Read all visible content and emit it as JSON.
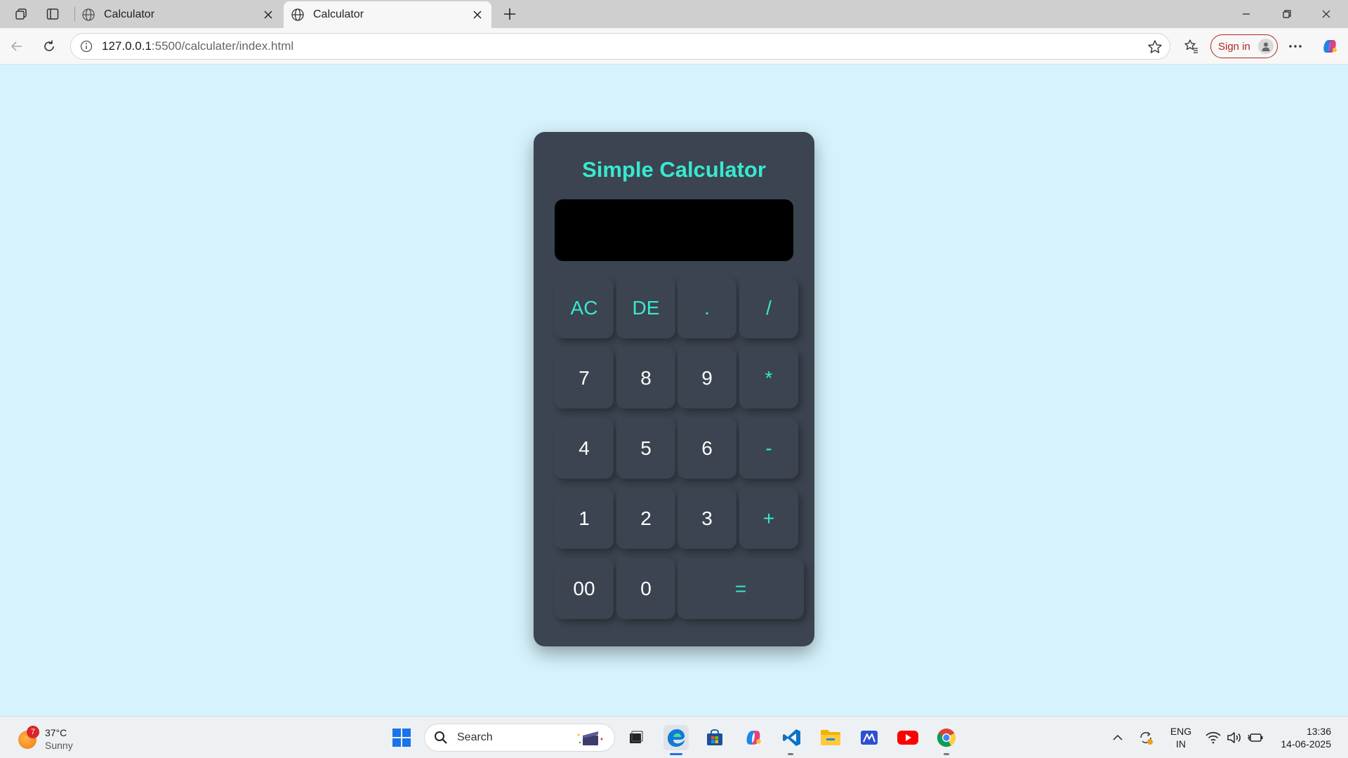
{
  "browser": {
    "tabs": [
      {
        "title": "Calculator",
        "active": false
      },
      {
        "title": "Calculator",
        "active": true
      }
    ],
    "url_host": "127.0.0.1",
    "url_path": ":5500/calculater/index.html",
    "signin_label": "Sign in"
  },
  "calculator": {
    "title": "Simple Calculator",
    "display_value": "",
    "accent_color": "#38e8d0",
    "keys": [
      "AC",
      "DE",
      ".",
      "/",
      "7",
      "8",
      "9",
      "*",
      "4",
      "5",
      "6",
      "-",
      "1",
      "2",
      "3",
      "+",
      "00",
      "0",
      "="
    ]
  },
  "taskbar": {
    "weather_temp": "37°C",
    "weather_condition": "Sunny",
    "weather_badge": "7",
    "search_label": "Search",
    "lang_line1": "ENG",
    "lang_line2": "IN",
    "time": "13:36",
    "date": "14-06-2025"
  }
}
